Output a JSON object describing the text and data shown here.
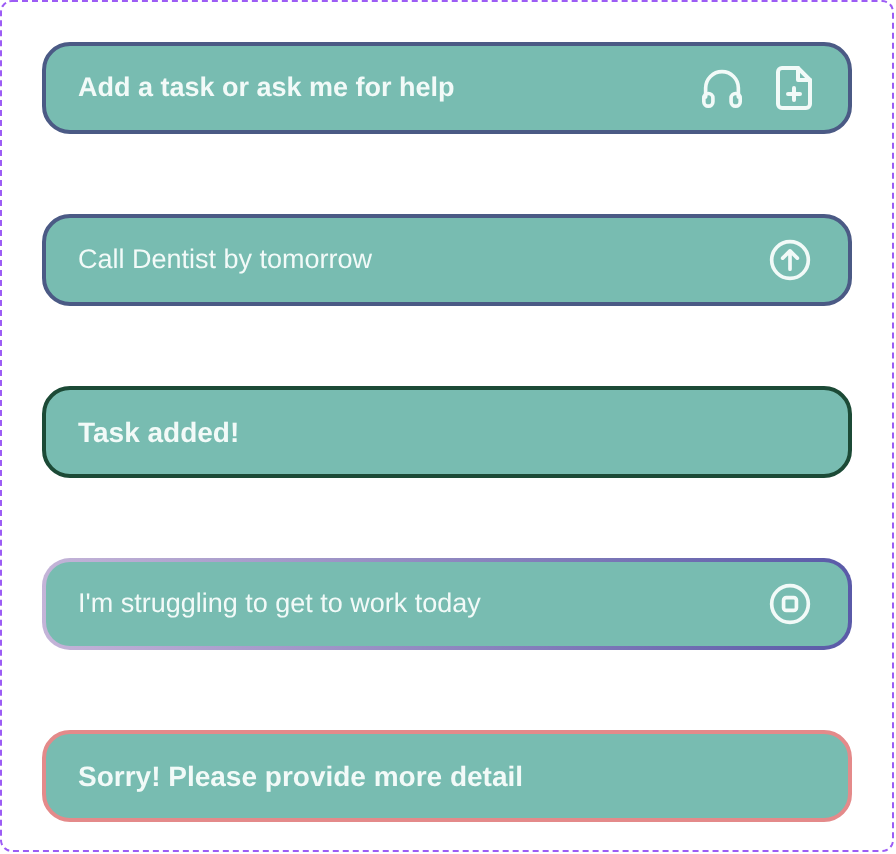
{
  "prompts": [
    {
      "kind": "empty",
      "placeholder": "Add a task or ask me for help"
    },
    {
      "kind": "typed",
      "value": "Call Dentist by tomorrow"
    },
    {
      "kind": "success",
      "message": "Task added!"
    },
    {
      "kind": "loading",
      "value": "I'm struggling to get to work today"
    },
    {
      "kind": "error",
      "message": "Sorry! Please provide more detail"
    }
  ]
}
